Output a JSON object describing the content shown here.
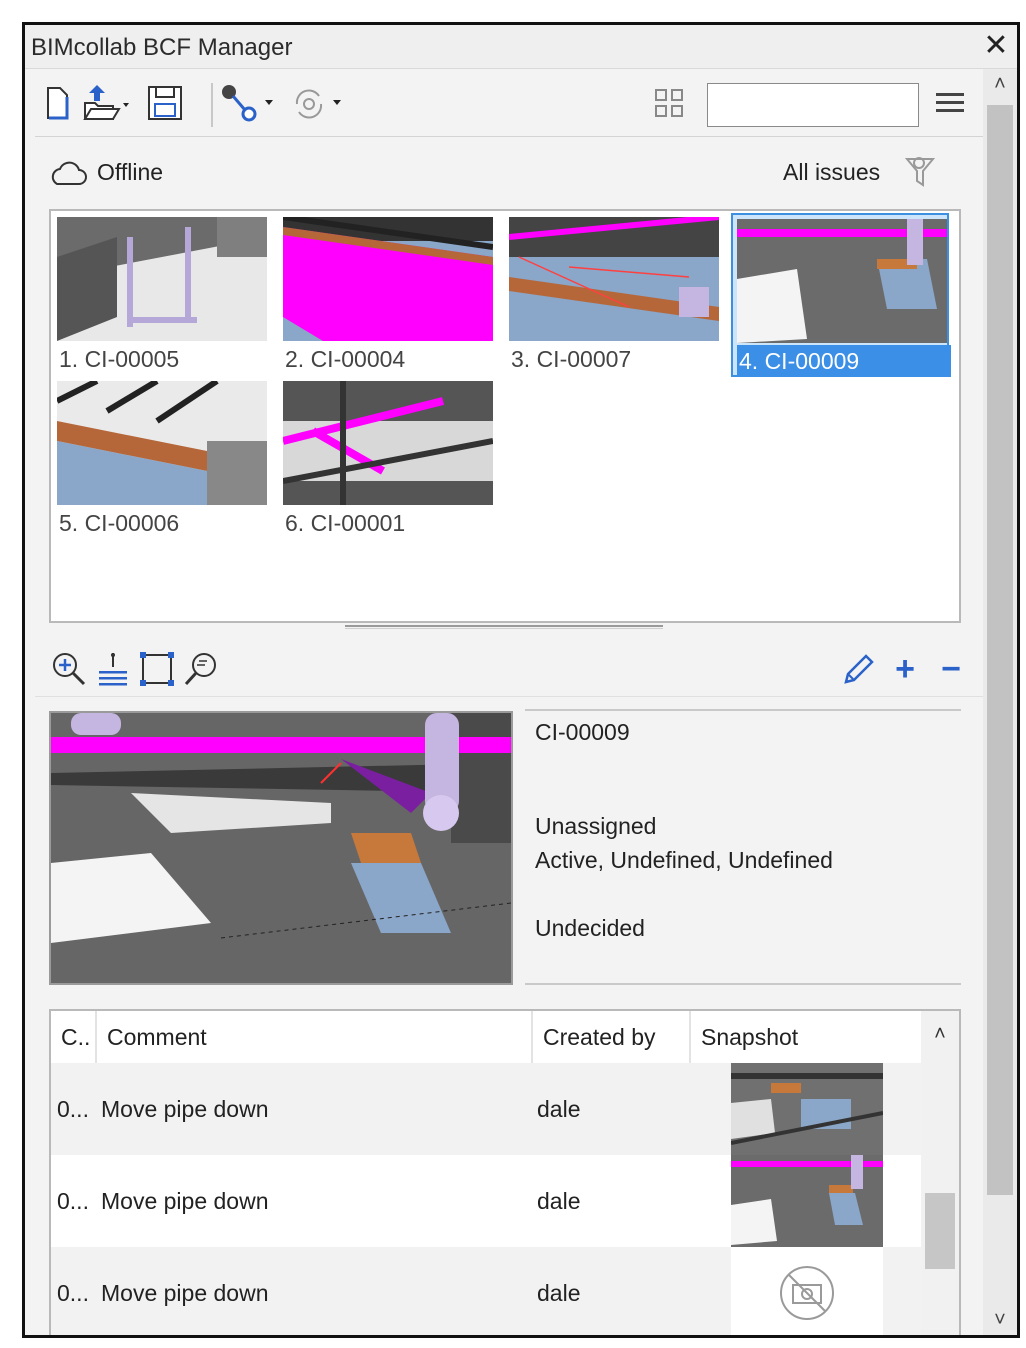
{
  "window": {
    "title": "BIMcollab BCF Manager",
    "close_glyph": "✕"
  },
  "toolbar": {
    "search_value": "",
    "icons": [
      "new-file-icon",
      "open-folder-icon",
      "save-icon",
      "connect-icon",
      "sync-icon",
      "grid-view-icon",
      "menu-icon"
    ],
    "dropdown_glyph": "▾"
  },
  "status": {
    "connection": "Offline",
    "filter": "All issues"
  },
  "issues": [
    {
      "label": "1. CI-00005",
      "selected": false
    },
    {
      "label": "2. CI-00004",
      "selected": false
    },
    {
      "label": "3. CI-00007",
      "selected": false
    },
    {
      "label": "4. CI-00009",
      "selected": true
    },
    {
      "label": "5. CI-00006",
      "selected": false
    },
    {
      "label": "6. CI-00001",
      "selected": false
    }
  ],
  "viewbar": {
    "add_glyph": "+",
    "remove_glyph": "−"
  },
  "details": {
    "id": "CI-00009",
    "assigned": "Unassigned",
    "state": "Active, Undefined, Undefined",
    "verdict": "Undecided"
  },
  "comments": {
    "headers": {
      "col1": "C..",
      "comment": "Comment",
      "created_by": "Created by",
      "snapshot": "Snapshot"
    },
    "rows": [
      {
        "date": "0...",
        "comment": "Move pipe down",
        "author": "dale",
        "snapshot": "image-a"
      },
      {
        "date": "0...",
        "comment": "Move pipe down",
        "author": "dale",
        "snapshot": "image-b"
      },
      {
        "date": "0...",
        "comment": "Move pipe down",
        "author": "dale",
        "snapshot": "no-snapshot-icon"
      }
    ]
  },
  "scroll": {
    "up_glyph": "˄",
    "down_glyph": "˅"
  },
  "colors": {
    "selection": "#3b8fe6",
    "accent_blue": "#2a62c9",
    "magenta": "#ff00ff"
  }
}
